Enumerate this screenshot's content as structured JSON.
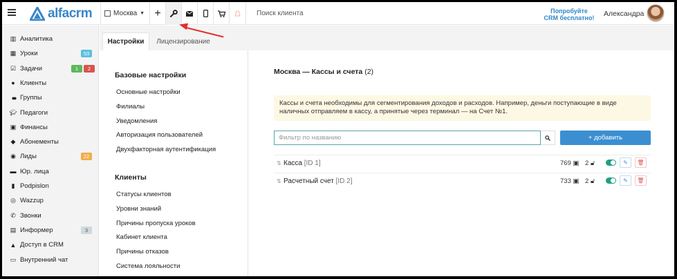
{
  "topbar": {
    "logo_text": "alfacrm",
    "branch": "Москва",
    "add_icon": "plus-icon",
    "settings_icon": "wrench-icon",
    "mail_icon": "mail-icon",
    "phone_icon": "phone-icon",
    "cart_icon": "cart-icon",
    "bell_icon": "bell-icon",
    "search_placeholder": "Поиск клиента",
    "try_line1": "Попробуйте",
    "try_line2": "CRM бесплатно!",
    "username": "Александра"
  },
  "sidebar": {
    "items": [
      {
        "label": "Аналитика",
        "icon": "analytics-icon"
      },
      {
        "label": "Уроки",
        "icon": "calendar-icon",
        "badges": [
          {
            "text": "53",
            "color": "#5bc0de"
          }
        ]
      },
      {
        "label": "Задачи",
        "icon": "tasks-icon",
        "badges": [
          {
            "text": "1",
            "color": "#5cb85c"
          },
          {
            "text": "2",
            "color": "#d9534f"
          }
        ]
      },
      {
        "label": "Клиенты",
        "icon": "user-icon"
      },
      {
        "label": "Группы",
        "icon": "users-icon"
      },
      {
        "label": "Педагоги",
        "icon": "teacher-icon"
      },
      {
        "label": "Финансы",
        "icon": "money-icon"
      },
      {
        "label": "Абонементы",
        "icon": "tag-icon"
      },
      {
        "label": "Лиды",
        "icon": "leads-icon",
        "badges": [
          {
            "text": "22",
            "color": "#f0ad4e"
          }
        ]
      },
      {
        "label": "Юр. лица",
        "icon": "briefcase-icon"
      },
      {
        "label": "Podpislon",
        "icon": "document-icon"
      },
      {
        "label": "Wazzup",
        "icon": "whatsapp-icon"
      },
      {
        "label": "Звонки",
        "icon": "phone-icon"
      },
      {
        "label": "Информер",
        "icon": "informer-icon",
        "badges": [
          {
            "text": "3",
            "color": "#cfd8dc"
          }
        ]
      },
      {
        "label": "Доступ в CRM",
        "icon": "lock-icon"
      },
      {
        "label": "Внутренний чат",
        "icon": "chat-icon"
      }
    ]
  },
  "tabs": [
    {
      "label": "Настройки",
      "active": true
    },
    {
      "label": "Лицензирование",
      "active": false
    }
  ],
  "settings_menu": {
    "basic_title": "Базовые настройки",
    "basic_links": [
      "Основные настройки",
      "Филиалы",
      "Уведомления",
      "Авторизация пользователей",
      "Двухфакторная аутентификация"
    ],
    "clients_title": "Клиенты",
    "clients_links": [
      "Статусы клиентов",
      "Уровни знаний",
      "Причины пропуска уроков",
      "Кабинет клиента",
      "Причины отказов",
      "Система лояльности"
    ]
  },
  "main": {
    "title": "Москва — Кассы и счета",
    "count": "(2)",
    "info_text": "Кассы и счета необходимы для сегментирования доходов и расходов. Например, деньги поступающие в виде наличных отправляем в кассу, а принятые через терминал — на Счет №1.",
    "filter_placeholder": "Фильтр по названию",
    "add_label": "+ добавить",
    "rows": [
      {
        "name": "Касса",
        "id": "[ID 1]",
        "count": "769",
        "users": "2"
      },
      {
        "name": "Расчетный счет",
        "id": "[ID 2]",
        "count": "733",
        "users": "2"
      }
    ]
  },
  "colors": {
    "accent": "#3b8fd1",
    "annotation_arrow": "#e0312b"
  }
}
